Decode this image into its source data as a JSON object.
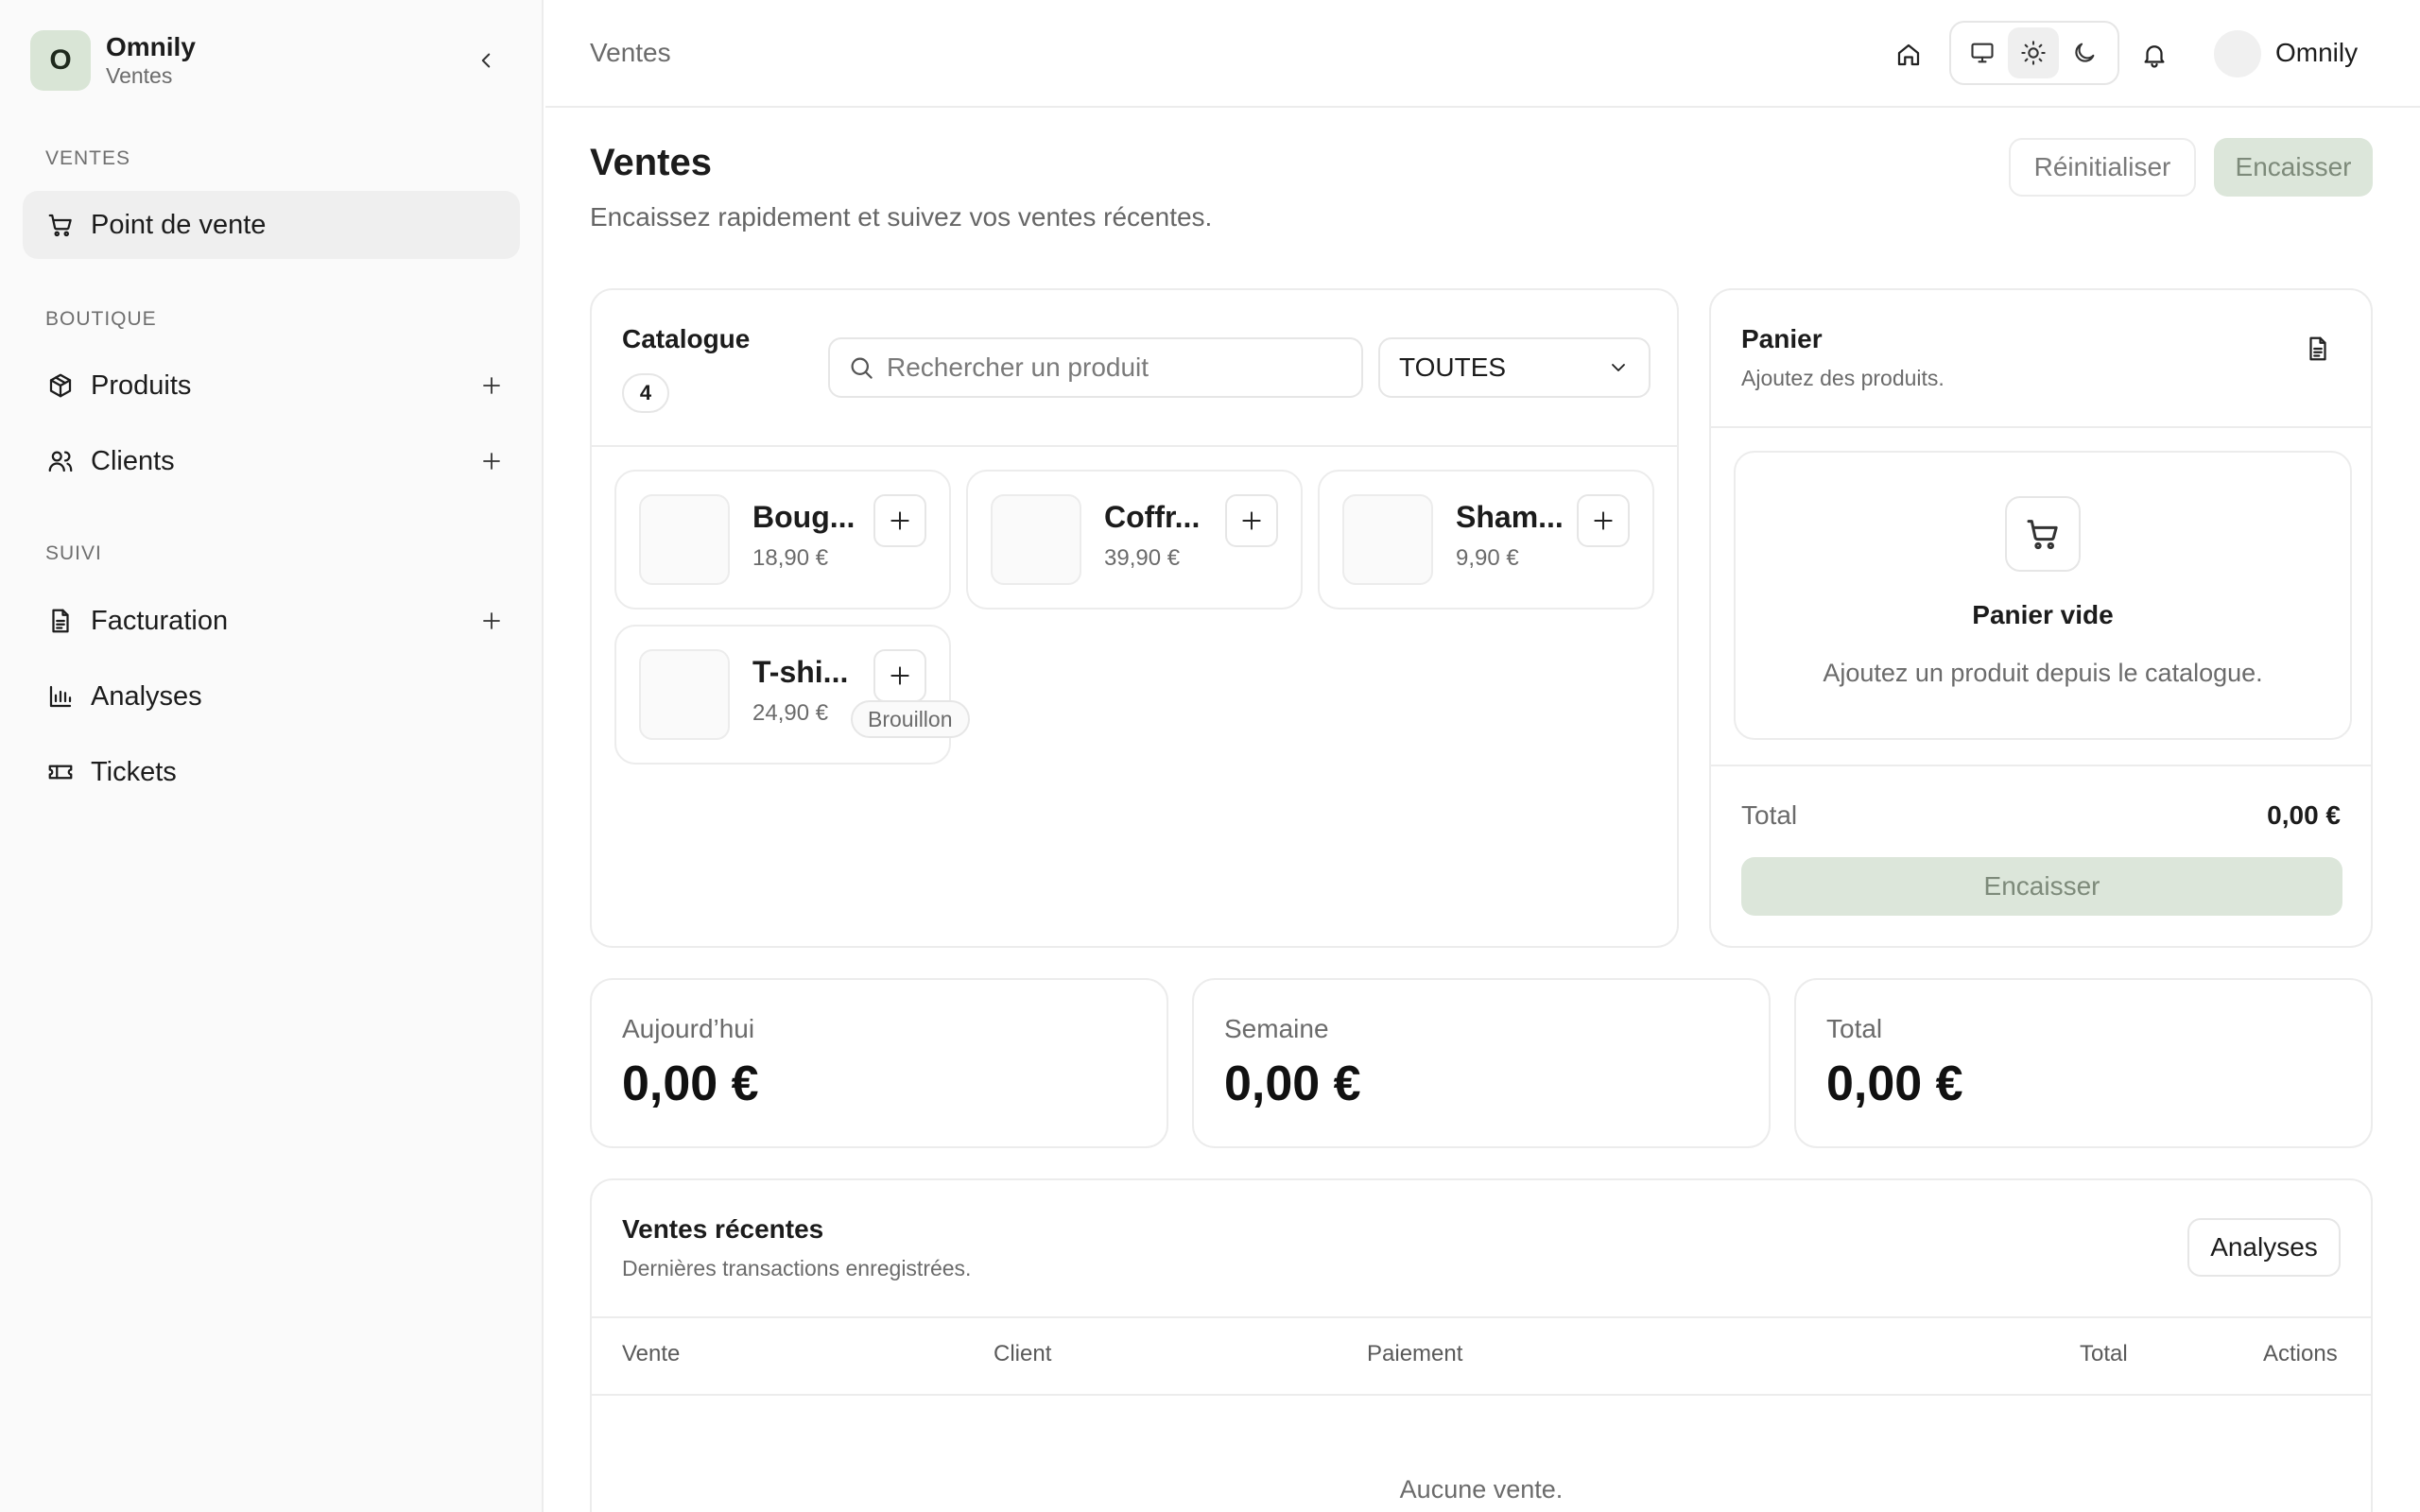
{
  "brand": {
    "initial": "O",
    "name": "Omnily",
    "module": "Ventes"
  },
  "sidebar": {
    "sections": [
      {
        "title": "VENTES",
        "items": [
          {
            "label": "Point de vente",
            "icon": "cart-icon",
            "active": true
          }
        ]
      },
      {
        "title": "BOUTIQUE",
        "items": [
          {
            "label": "Produits",
            "icon": "package-icon"
          },
          {
            "label": "Clients",
            "icon": "users-icon"
          }
        ]
      },
      {
        "title": "SUIVI",
        "items": [
          {
            "label": "Facturation",
            "icon": "document-icon"
          },
          {
            "label": "Analyses",
            "icon": "bar-chart-icon"
          },
          {
            "label": "Tickets",
            "icon": "ticket-icon"
          }
        ]
      }
    ]
  },
  "header": {
    "breadcrumb": "Ventes",
    "user_name": "Omnily",
    "theme_selected": "light"
  },
  "page": {
    "title": "Ventes",
    "subtitle": "Encaissez rapidement et suivez vos ventes récentes.",
    "reset_label": "Réinitialiser",
    "checkout_label": "Encaisser"
  },
  "catalogue": {
    "title": "Catalogue",
    "count": "4",
    "search_placeholder": "Rechercher un produit",
    "filter_value": "TOUTES",
    "products": [
      {
        "name": "Boug...",
        "price": "18,90 €"
      },
      {
        "name": "Coffr...",
        "price": "39,90 €"
      },
      {
        "name": "Sham...",
        "price": "9,90 €"
      },
      {
        "name": "T-shi...",
        "price": "24,90 €",
        "badge": "Brouillon"
      }
    ]
  },
  "cart": {
    "title": "Panier",
    "subtitle": "Ajoutez des produits.",
    "empty_title": "Panier vide",
    "empty_text": "Ajoutez un produit depuis le catalogue.",
    "total_label": "Total",
    "total_value": "0,00 €",
    "checkout_label": "Encaisser"
  },
  "stats": [
    {
      "label": "Aujourd’hui",
      "value": "0,00 €"
    },
    {
      "label": "Semaine",
      "value": "0,00 €"
    },
    {
      "label": "Total",
      "value": "0,00 €"
    }
  ],
  "recent": {
    "title": "Ventes récentes",
    "subtitle": "Dernières transactions enregistrées.",
    "button_label": "Analyses",
    "columns": [
      "Vente",
      "Client",
      "Paiement",
      "Total",
      "Actions"
    ],
    "empty_text": "Aucune vente."
  },
  "colors": {
    "accent": "#dce6da",
    "accent_text": "#7d8a7a",
    "border": "#ececec"
  }
}
